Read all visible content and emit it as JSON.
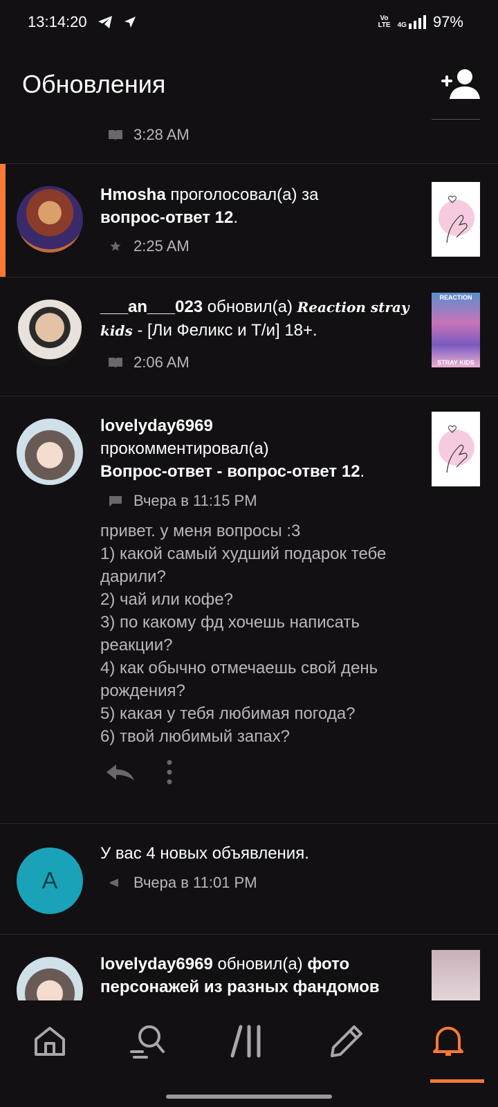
{
  "status": {
    "time": "13:14:20",
    "battery": "97%",
    "volte": "Vo\nLTE",
    "net": "4G"
  },
  "header": {
    "title": "Обновления"
  },
  "feed": [
    {
      "meta": "3:28 AM"
    },
    {
      "user": "Hmosha",
      "action": " проголосовал(а) за ",
      "target": "вопрос-ответ 12",
      "end": ".",
      "meta": "2:25 AM"
    },
    {
      "user": "___an___023",
      "action": " обновил(а) ",
      "target_fancy": "Reaction stray kids",
      "target": " - [Ли Феликс и Т/и] 18+",
      "end": ".",
      "meta": "2:06 AM",
      "thumb_top": "REACTION",
      "thumb_bottom": "STRAY KIDS"
    },
    {
      "user": "lovelyday6969",
      "action": "прокомментировал(а)",
      "target": "Вопрос-ответ - вопрос-ответ 12",
      "end": ".",
      "meta": "Вчера в 11:15 PM",
      "comment": "привет. у меня вопросы :3\n1) какой самый худший подарок тебе дарили?\n2) чай или кофе?\n3) по какому фд хочешь написать реакции?\n4) как обычно отмечаешь свой день рождения?\n5) какая у тебя любимая погода?\n6) твой любимый запах?"
    },
    {
      "avatar_letter": "A",
      "text": "У вас 4 новых объявления.",
      "meta": "Вчера в 11:01 PM"
    },
    {
      "user": "lovelyday6969",
      "action": " обновил(а) ",
      "target": "фото персонажей из разных фандомов"
    }
  ],
  "colors": {
    "accent": "#ff7a35",
    "background": "#121013",
    "muted": "#b9b7ba",
    "announce_avatar": "#1aa3b8"
  },
  "tabs": [
    "home-icon",
    "search-icon",
    "library-icon",
    "write-icon",
    "bell-icon"
  ]
}
